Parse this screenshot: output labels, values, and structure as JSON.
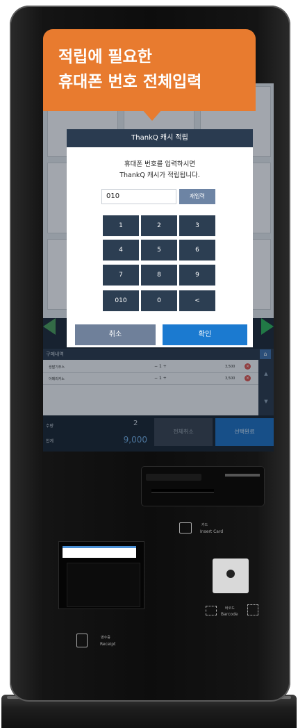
{
  "callout": {
    "line1": "적립에 필요한",
    "line2": "휴대폰 번호 전체입력"
  },
  "dialog": {
    "title": "ThankQ 캐시 적립",
    "message_line1": "휴대폰 번호를 입력하시면",
    "message_line2": "ThankQ 캐시가 적립됩니다.",
    "phone_value": "010",
    "reenter_label": "재입력",
    "keypad": [
      "1",
      "2",
      "3",
      "4",
      "5",
      "6",
      "7",
      "8",
      "9",
      "010",
      "0",
      "<"
    ],
    "cancel_label": "취소",
    "confirm_label": "확인"
  },
  "background_app": {
    "cart_title": "구매내역",
    "home_icon": "home-icon",
    "cart_items": [
      {
        "name": "생딸기주스",
        "qty": "1",
        "price": "3,500"
      },
      {
        "name": "아메리카노",
        "qty": "1",
        "price": "3,500"
      }
    ],
    "qty_label": "수량",
    "qty_value": "2",
    "sum_label": "합계",
    "sum_value": "9,000",
    "cancel_all_label": "전체취소",
    "done_label": "선택완료"
  },
  "hardware": {
    "card_label_ko": "카드",
    "card_label_en": "Insert Card",
    "receipt_label_ko": "영수증",
    "receipt_label_en": "Receipt",
    "barcode_label_ko": "바코드",
    "barcode_label_en": "Barcode"
  },
  "colors": {
    "callout": "#e87b2f",
    "dialog_header": "#2a3b50",
    "keypad": "#2c3e52",
    "confirm": "#1b7ad0",
    "cancel": "#6f809a"
  }
}
